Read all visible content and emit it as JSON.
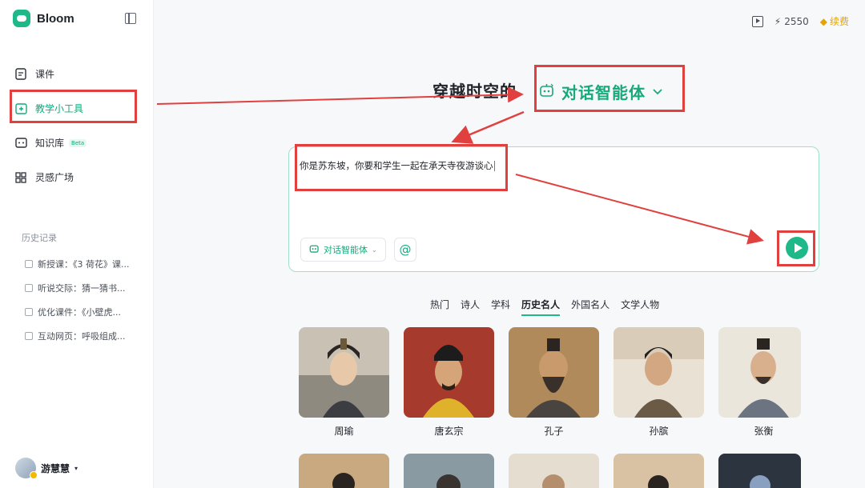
{
  "brand": {
    "name": "Bloom"
  },
  "nav": [
    {
      "label": "课件",
      "icon": "courseware-icon"
    },
    {
      "label": "教学小工具",
      "icon": "teaching-tools-icon",
      "active": true
    },
    {
      "label": "知识库",
      "icon": "knowledge-base-icon",
      "badge": "Beta"
    },
    {
      "label": "灵感广场",
      "icon": "grid-icon"
    }
  ],
  "history": {
    "title": "历史记录",
    "items": [
      "新授课：《3 荷花》课...",
      "听说交际：猜一猜书...",
      "优化课件：《小壁虎...",
      "互动网页：呼吸组成..."
    ]
  },
  "user": {
    "name": "游慧慧"
  },
  "topbar": {
    "credits": "2550",
    "renew": "续费"
  },
  "heading": {
    "prefix": "穿越时空的",
    "agent": "对话智能体"
  },
  "chat": {
    "prompt": "你是苏东坡，你要和学生一起在承天寺夜游谈心",
    "agent_button": "对话智能体",
    "at_symbol": "@"
  },
  "tabs": [
    "热门",
    "诗人",
    "学科",
    "历史名人",
    "外国名人",
    "文学人物"
  ],
  "active_tab": "历史名人",
  "figures": [
    "周瑜",
    "唐玄宗",
    "孔子",
    "孙膑",
    "张衡"
  ],
  "colors": {
    "accent": "#1fb889",
    "annotation": "#e0413f"
  }
}
